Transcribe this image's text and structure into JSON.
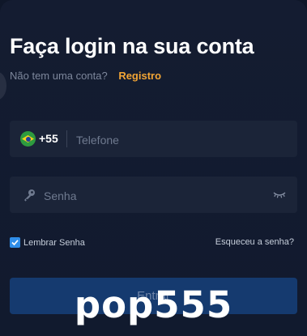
{
  "login": {
    "title": "Faça login na sua conta",
    "no_account_text": "Não tem uma conta?",
    "register_link": "Registro"
  },
  "phone": {
    "country_flag": "brazil-flag-icon",
    "dial_code": "+55",
    "placeholder": "Telefone",
    "value": ""
  },
  "password": {
    "icon": "key-icon",
    "placeholder": "Senha",
    "value": "",
    "toggle_icon": "eye-closed-icon"
  },
  "options": {
    "remember_label": "Lembrar Senha",
    "remember_checked": true,
    "forgot_link": "Esqueceu a senha?"
  },
  "submit": {
    "label": "Entrar"
  },
  "watermark": {
    "text": "pop555"
  },
  "colors": {
    "background": "#0f1729",
    "field": "#1b2438",
    "accent": "#f2a535",
    "button": "#153a6f",
    "checkbox": "#2f8de8"
  }
}
